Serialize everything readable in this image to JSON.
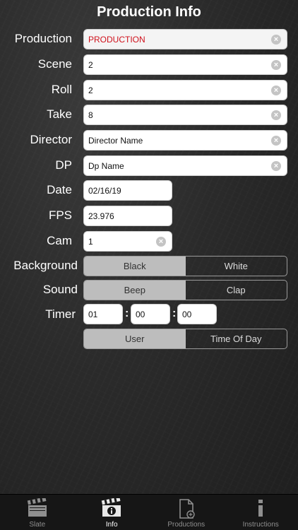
{
  "header": {
    "title": "Production Info"
  },
  "fields": {
    "production": {
      "label": "Production",
      "value": "PRODUCTION"
    },
    "scene": {
      "label": "Scene",
      "value": "2"
    },
    "roll": {
      "label": "Roll",
      "value": "2"
    },
    "take": {
      "label": "Take",
      "value": "8"
    },
    "director": {
      "label": "Director",
      "value": "Director Name"
    },
    "dp": {
      "label": "DP",
      "value": "Dp Name"
    },
    "date": {
      "label": "Date",
      "value": "02/16/19"
    },
    "fps": {
      "label": "FPS",
      "value": "23.976"
    },
    "cam": {
      "label": "Cam",
      "value": "1"
    }
  },
  "background": {
    "label": "Background",
    "options": [
      "Black",
      "White"
    ],
    "selected": "Black"
  },
  "sound": {
    "label": "Sound",
    "options": [
      "Beep",
      "Clap"
    ],
    "selected": "Beep"
  },
  "timer": {
    "label": "Timer",
    "hours": "01",
    "minutes": "00",
    "seconds": "00",
    "separator": ":",
    "mode_options": [
      "User",
      "Time Of Day"
    ],
    "mode_selected": "User"
  },
  "tabbar": {
    "items": [
      {
        "label": "Slate",
        "icon": "clapperboard-icon"
      },
      {
        "label": "Info",
        "icon": "clapperboard-info-icon",
        "active": true
      },
      {
        "label": "Productions",
        "icon": "document-add-icon"
      },
      {
        "label": "Instructions",
        "icon": "info-icon"
      }
    ]
  },
  "colors": {
    "accent_red": "#d0111b",
    "segment_selected": "#bdbdbd"
  }
}
